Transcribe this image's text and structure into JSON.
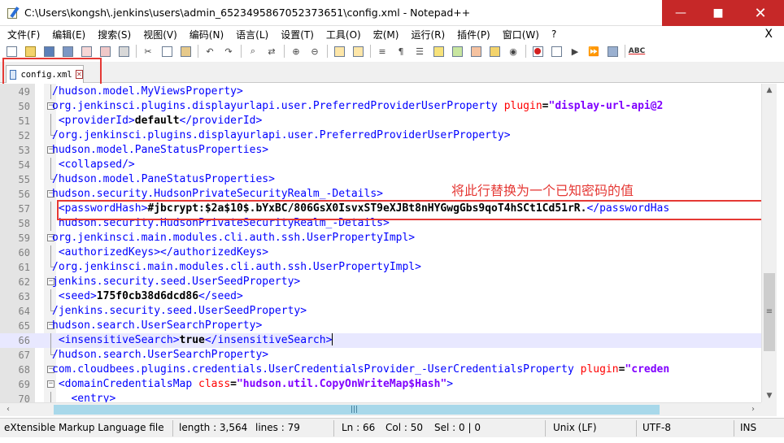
{
  "window": {
    "title": "C:\\Users\\kongsh\\.jenkins\\users\\admin_6523495867052373651\\config.xml - Notepad++",
    "minimize": "—",
    "maximize": "■",
    "close": "✕"
  },
  "menu": {
    "items": [
      "文件(F)",
      "编辑(E)",
      "搜索(S)",
      "视图(V)",
      "编码(N)",
      "语言(L)",
      "设置(T)",
      "工具(O)",
      "宏(M)",
      "运行(R)",
      "插件(P)",
      "窗口(W)",
      "?"
    ],
    "close": "X"
  },
  "toolbar": {
    "spellcheck_label": "ABC"
  },
  "tabs": [
    {
      "label": "config.xml",
      "close": "✕"
    }
  ],
  "annotation": "将此行替换为一个已知密码的值",
  "editor": {
    "lines": [
      {
        "n": "49",
        "parts": [
          [
            "tag",
            "/hudson.model.MyViewsProperty>"
          ]
        ]
      },
      {
        "n": "50",
        "parts": [
          [
            "tag",
            "org.jenkinsci.plugins.displayurlapi.user.PreferredProviderUserProperty "
          ],
          [
            "attr",
            "plugin"
          ],
          [
            "txt",
            "="
          ],
          [
            "val",
            "\"display-url-api@2"
          ]
        ]
      },
      {
        "n": "51",
        "parts": [
          [
            "tag",
            " <providerId>"
          ],
          [
            "txt",
            "default"
          ],
          [
            "tag",
            "</providerId>"
          ]
        ]
      },
      {
        "n": "52",
        "parts": [
          [
            "tag",
            "/org.jenkinsci.plugins.displayurlapi.user.PreferredProviderUserProperty>"
          ]
        ]
      },
      {
        "n": "53",
        "parts": [
          [
            "tag",
            "hudson.model.PaneStatusProperties>"
          ]
        ]
      },
      {
        "n": "54",
        "parts": [
          [
            "tag",
            " <collapsed/>"
          ]
        ]
      },
      {
        "n": "55",
        "parts": [
          [
            "tag",
            "/hudson.model.PaneStatusProperties>"
          ]
        ]
      },
      {
        "n": "56",
        "parts": [
          [
            "tag",
            "hudson.security.HudsonPrivateSecurityRealm_-Details>"
          ]
        ]
      },
      {
        "n": "57",
        "parts": [
          [
            "tag",
            " <passwordHash>"
          ],
          [
            "txt",
            "#jbcrypt:$2a$10$.bYxBC/806GsX0IsvxST9eXJBt8nHYGwgGbs9qoT4hSCt1Cd51rR."
          ],
          [
            "tag",
            "</passwordHas"
          ]
        ]
      },
      {
        "n": "58",
        "parts": [
          [
            "tag",
            " hudson.security.HudsonPrivateSecurityRealm_-Details>"
          ]
        ]
      },
      {
        "n": "59",
        "parts": [
          [
            "tag",
            "org.jenkinsci.main.modules.cli.auth.ssh.UserPropertyImpl>"
          ]
        ]
      },
      {
        "n": "60",
        "parts": [
          [
            "tag",
            " <authorizedKeys></authorizedKeys>"
          ]
        ]
      },
      {
        "n": "61",
        "parts": [
          [
            "tag",
            "/org.jenkinsci.main.modules.cli.auth.ssh.UserPropertyImpl>"
          ]
        ]
      },
      {
        "n": "62",
        "parts": [
          [
            "tag",
            "jenkins.security.seed.UserSeedProperty>"
          ]
        ]
      },
      {
        "n": "63",
        "parts": [
          [
            "tag",
            " <seed>"
          ],
          [
            "txt",
            "175f0cb38d6dcd86"
          ],
          [
            "tag",
            "</seed>"
          ]
        ]
      },
      {
        "n": "64",
        "parts": [
          [
            "tag",
            "/jenkins.security.seed.UserSeedProperty>"
          ]
        ]
      },
      {
        "n": "65",
        "parts": [
          [
            "tag",
            "hudson.search.UserSearchProperty>"
          ]
        ]
      },
      {
        "n": "66",
        "parts": [
          [
            "tag",
            " <insensitiveSearch>"
          ],
          [
            "txt",
            "true"
          ],
          [
            "tag",
            "</insensitiveSearch>"
          ]
        ]
      },
      {
        "n": "67",
        "parts": [
          [
            "tag",
            "/hudson.search.UserSearchProperty>"
          ]
        ]
      },
      {
        "n": "68",
        "parts": [
          [
            "tag",
            "com.cloudbees.plugins.credentials.UserCredentialsProvider_-UserCredentialsProperty "
          ],
          [
            "attr",
            "plugin"
          ],
          [
            "txt",
            "="
          ],
          [
            "val",
            "\"creden"
          ]
        ]
      },
      {
        "n": "69",
        "parts": [
          [
            "tag",
            " <domainCredentialsMap "
          ],
          [
            "attr",
            "class"
          ],
          [
            "txt",
            "="
          ],
          [
            "val",
            "\"hudson.util.CopyOnWriteMap$Hash\""
          ],
          [
            "tag",
            ">"
          ]
        ]
      },
      {
        "n": "70",
        "parts": [
          [
            "tag",
            "   <entry>"
          ]
        ]
      }
    ]
  },
  "statusbar": {
    "language": "eXtensible Markup Language file",
    "length": "length : 3,564",
    "lines": "lines : 79",
    "ln": "Ln : 66",
    "col": "Col : 50",
    "sel": "Sel : 0 | 0",
    "eol": "Unix (LF)",
    "encoding": "UTF-8",
    "mode": "INS"
  }
}
